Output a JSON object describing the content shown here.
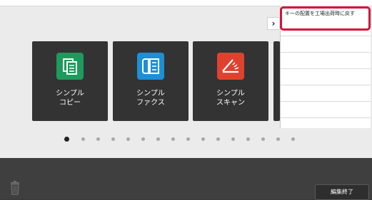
{
  "tiles": [
    {
      "label_line1": "シンプル",
      "label_line2": "コピー",
      "icon": "copy-icon",
      "color": "#1e9a5b"
    },
    {
      "label_line1": "シンプル",
      "label_line2": "ファクス",
      "icon": "fax-icon",
      "color": "#1d8fd6"
    },
    {
      "label_line1": "シンプル",
      "label_line2": "スキャン",
      "icon": "scan-icon",
      "color": "#e0412f"
    }
  ],
  "page_indicator": {
    "total": 14,
    "current": 1
  },
  "side_menu": {
    "item_1": "キーの配置を工場出荷時に戻す"
  },
  "footer": {
    "finish_label": "編集終了"
  },
  "colors": {
    "highlight": "#d6113a",
    "background": "#ebebeb",
    "bottom_bar": "#3f3f3f"
  }
}
